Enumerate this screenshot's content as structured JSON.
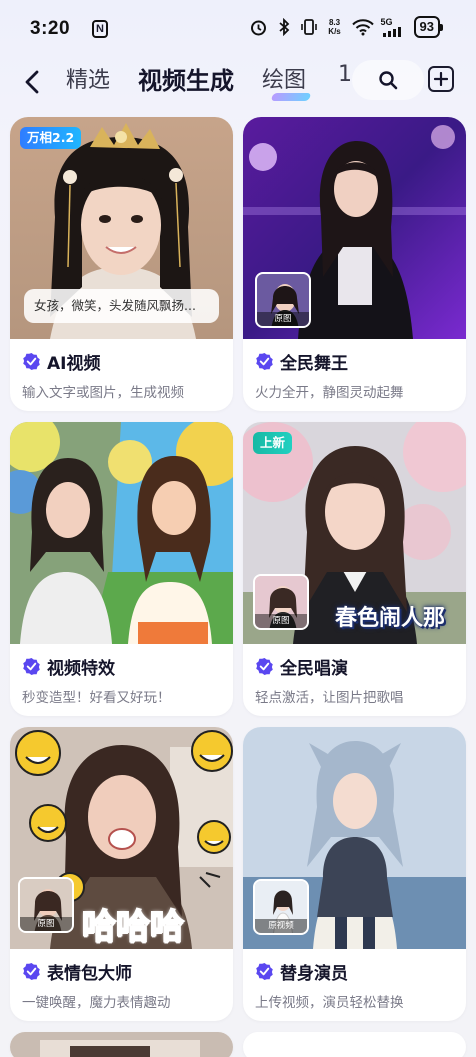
{
  "status_bar": {
    "time": "3:20",
    "net_speed_top": "8.3",
    "net_speed_bottom": "K/s",
    "network": "5G",
    "battery": "93"
  },
  "nav": {
    "tabs": [
      {
        "label": "精选",
        "active": false
      },
      {
        "label": "视频生成",
        "active": true
      },
      {
        "label": "绘图",
        "active": false
      },
      {
        "label": "1",
        "active": false
      }
    ]
  },
  "cards": [
    {
      "title": "AI视频",
      "desc": "输入文字或图片，生成视频",
      "badge": "万相2.2",
      "prompt": "女孩，微笑，头发随风飘扬..."
    },
    {
      "title": "全民舞王",
      "desc": "火力全开，静图灵动起舞",
      "ref_label": "原图"
    },
    {
      "title": "视频特效",
      "desc": "秒变造型！好看又好玩！"
    },
    {
      "title": "全民唱演",
      "desc": "轻点激活，让图片把歌唱",
      "badge": "上新",
      "ref_label": "原图",
      "overlay": "春色闹人那"
    },
    {
      "title": "表情包大师",
      "desc": "一键唤醒，魔力表情趣动",
      "ref_label": "原图",
      "overlay": "哈哈哈"
    },
    {
      "title": "替身演员",
      "desc": "上传视频，演员轻松替换",
      "ref_label": "原视频"
    }
  ],
  "colors": {
    "accent": "#5b4cf5",
    "verified": "#5a47f0"
  }
}
